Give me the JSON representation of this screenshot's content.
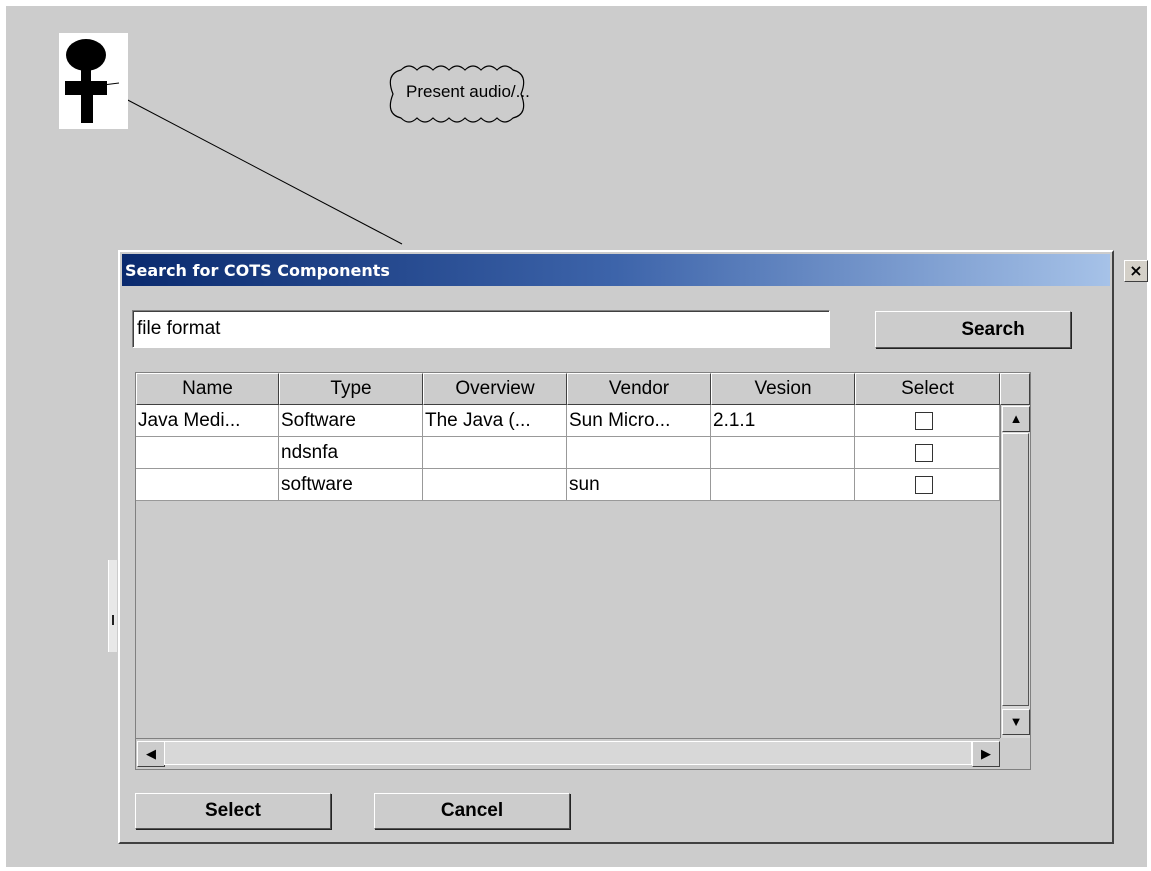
{
  "diagram": {
    "usecase_label": "Present audio/..."
  },
  "dialog": {
    "title": "Search for COTS Components",
    "close_glyph": "×",
    "search": {
      "value": "file format",
      "button_label": "Search"
    },
    "table": {
      "columns": [
        "Name",
        "Type",
        "Overview",
        "Vendor",
        "Vesion",
        "Select"
      ],
      "rows": [
        {
          "name": "Java Medi...",
          "type": "Software",
          "overview": "The Java (...",
          "vendor": "Sun Micro...",
          "version": "2.1.1",
          "selected": false
        },
        {
          "name": "",
          "type": "ndsnfa",
          "overview": "",
          "vendor": "",
          "version": "",
          "selected": false
        },
        {
          "name": "",
          "type": "software",
          "overview": "",
          "vendor": "sun",
          "version": "",
          "selected": false
        }
      ]
    },
    "scroll_icons": {
      "up": "▲",
      "down": "▼",
      "left": "◀",
      "right": "▶"
    },
    "buttons": {
      "select_label": "Select",
      "cancel_label": "Cancel"
    }
  }
}
